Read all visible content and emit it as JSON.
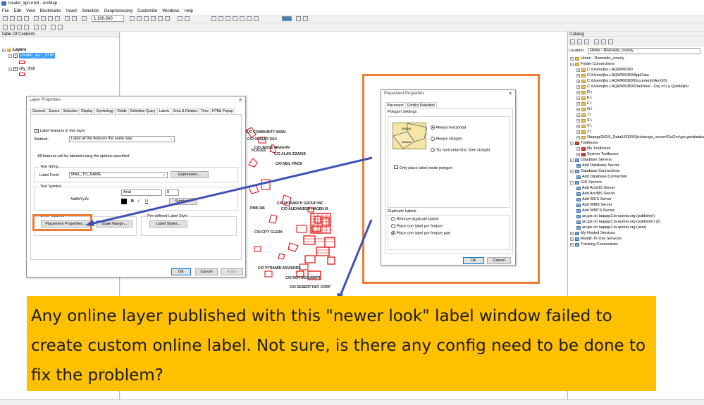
{
  "window": {
    "title": "invalid_apn.mxd - ArcMap"
  },
  "menu": [
    "File",
    "Edit",
    "View",
    "Bookmarks",
    "Insert",
    "Selection",
    "Geoprocessing",
    "Customize",
    "Windows",
    "Help"
  ],
  "toolbar": {
    "scale": "1:100,000"
  },
  "toc": {
    "title": "Table Of Contents",
    "layers_label": "Layers",
    "layers": [
      {
        "name": "invalid_apn_2016",
        "checked": true,
        "selected": true
      },
      {
        "name": "city_limit",
        "checked": true,
        "selected": false
      }
    ]
  },
  "layer_properties": {
    "title": "Layer Properties",
    "tabs": [
      "General",
      "Source",
      "Selection",
      "Display",
      "Symbology",
      "Fields",
      "Definition Query",
      "Labels",
      "Joins & Relates",
      "Time",
      "HTML Popup"
    ],
    "active_tab": "Labels",
    "label_features": "Label features in this layer",
    "method_label": "Method:",
    "method_value": "Label all the features the same way",
    "info": "All features will be labeled using the options specified.",
    "text_string": "Text String",
    "label_field_label": "Label Field:",
    "label_field_value": "MAIL_TO_NAME",
    "expression_btn": "Expression...",
    "text_symbol": "Text Symbol",
    "sample": "AaBbYyZz",
    "font": "Arial",
    "size": "8",
    "bold": "B",
    "italic": "I",
    "underline": "U",
    "symbol_btn": "Symbol...",
    "other_options": "Other Options",
    "placement_btn": "Placement Properties...",
    "scale_range_btn": "Scale Range...",
    "predefined": "Pre-defined Label Style",
    "label_styles_btn": "Label Styles...",
    "ok": "OK",
    "cancel": "Cancel",
    "apply": "Apply"
  },
  "placement_properties": {
    "title": "Placement Properties",
    "tabs": [
      "Placement",
      "Conflict Detection"
    ],
    "active_tab": "Placement",
    "polygon_settings": "Polygon Settings",
    "preview_labels": [
      "556646",
      "556645"
    ],
    "options": [
      {
        "label": "Always horizontal",
        "selected": true
      },
      {
        "label": "Always straight",
        "selected": false
      },
      {
        "label": "Try horizontal first, then straight",
        "selected": false
      }
    ],
    "only_inside": "Only place label inside polygon",
    "duplicate_labels": "Duplicate Labels",
    "duplicate_options": [
      {
        "label": "Remove duplicate labels",
        "selected": false
      },
      {
        "label": "Place one label per feature",
        "selected": false
      },
      {
        "label": "Place one label per feature part",
        "selected": true
      }
    ],
    "ok": "OK",
    "cancel": "Cancel"
  },
  "catalog": {
    "title": "Catalog",
    "location_label": "Location:",
    "location_value": "Home - Riverside_county",
    "items": [
      {
        "label": "Home - Riverside_county",
        "icon": "folder-icon",
        "indent": 0
      },
      {
        "label": "Folder Connections",
        "icon": "folder-icon",
        "indent": 0
      },
      {
        "label": "C:\\Users\\jhu.LAQWRK080",
        "icon": "folder-icon",
        "indent": 1
      },
      {
        "label": "C:\\Users\\jhu.LAQWRK080\\AppData",
        "icon": "folder-icon",
        "indent": 1
      },
      {
        "label": "C:\\Users\\jhu.LAQWRK080\\Documents\\ArcGIS",
        "icon": "folder-icon",
        "indent": 1
      },
      {
        "label": "C:\\Users\\jhu.LAQWRK080\\OneDrive - City of La Quinta\\jhu",
        "icon": "folder-icon",
        "indent": 1
      },
      {
        "label": "D:\\",
        "icon": "folder-icon",
        "indent": 1
      },
      {
        "label": "E:\\",
        "icon": "folder-icon",
        "indent": 1
      },
      {
        "label": "F:\\",
        "icon": "folder-icon",
        "indent": 1
      },
      {
        "label": "G:\\",
        "icon": "folder-icon",
        "indent": 1
      },
      {
        "label": "J:\\",
        "icon": "folder-icon",
        "indent": 1
      },
      {
        "label": "S:\\",
        "icon": "folder-icon",
        "indent": 1
      },
      {
        "label": "V:\\",
        "icon": "folder-icon",
        "indent": 1
      },
      {
        "label": "Z:\\",
        "icon": "folder-icon",
        "indent": 1
      },
      {
        "label": "\\\\laqapp2\\GIS_Data\\USERS\\jhu\\arcgis_server\\GoGov\\gis.geodatabase",
        "icon": "folder-icon",
        "indent": 1
      },
      {
        "label": "Toolboxes",
        "icon": "toolbox-icon",
        "indent": 0
      },
      {
        "label": "My Toolboxes",
        "icon": "toolbox-icon",
        "indent": 1
      },
      {
        "label": "System Toolboxes",
        "icon": "toolbox-icon",
        "indent": 1
      },
      {
        "label": "Database Servers",
        "icon": "server-icon",
        "indent": 0
      },
      {
        "label": "Add Database Server",
        "icon": "server-icon",
        "indent": 1
      },
      {
        "label": "Database Connections",
        "icon": "server-icon",
        "indent": 0
      },
      {
        "label": "Add Database Connection",
        "icon": "server-icon",
        "indent": 1
      },
      {
        "label": "GIS Servers",
        "icon": "server-icon",
        "indent": 0
      },
      {
        "label": "Add ArcGIS Server",
        "icon": "server-icon",
        "indent": 1
      },
      {
        "label": "Add ArcIMS Server",
        "icon": "server-icon",
        "indent": 1
      },
      {
        "label": "Add WCS Server",
        "icon": "server-icon",
        "indent": 1
      },
      {
        "label": "Add WMS Server",
        "icon": "server-icon",
        "indent": 1
      },
      {
        "label": "Add WMTS Server",
        "icon": "server-icon",
        "indent": 1
      },
      {
        "label": "arcgis on laqapp2.la-quinta.org (publisher)",
        "icon": "server-icon",
        "indent": 1
      },
      {
        "label": "arcgis on laqapp2.la-quinta.org (publisher) (2)",
        "icon": "server-icon",
        "indent": 1
      },
      {
        "label": "arcgis on laqapp2.la-quinta.org (user)",
        "icon": "server-icon",
        "indent": 1
      },
      {
        "label": "My Hosted Services",
        "icon": "server-icon",
        "indent": 0
      },
      {
        "label": "Ready-To-Use Services",
        "icon": "server-icon",
        "indent": 0
      },
      {
        "label": "Tracking Connections",
        "icon": "server-icon",
        "indent": 0
      }
    ]
  },
  "map_labels": [
    "C/O COMMUNITY ASSN",
    "C/O DESERT DEV",
    "C/O JESSE ARAGON",
    "PLACES",
    "C/O ALAN ZIZAKIS",
    "C/O NEIL FINCH",
    "C/O MONARCH GROUP INC",
    "C/O ALEXANDER HAGEN III",
    "C/O PYRAMID ADVISORS",
    "C/O ROY SCHUBERT",
    "C/O DESERT DEV CORP",
    "PMB 186",
    "C/O CITY CLERK"
  ],
  "caption": "Any online layer published with this \"newer look\" label window failed to create custom online label.  Not sure, is there any config need to be done to fix the problem?",
  "colors": {
    "highlight": "#ed7d31",
    "arrow": "#3f51b5",
    "caption_bg": "#ffc000",
    "parcel": "#e00000"
  }
}
